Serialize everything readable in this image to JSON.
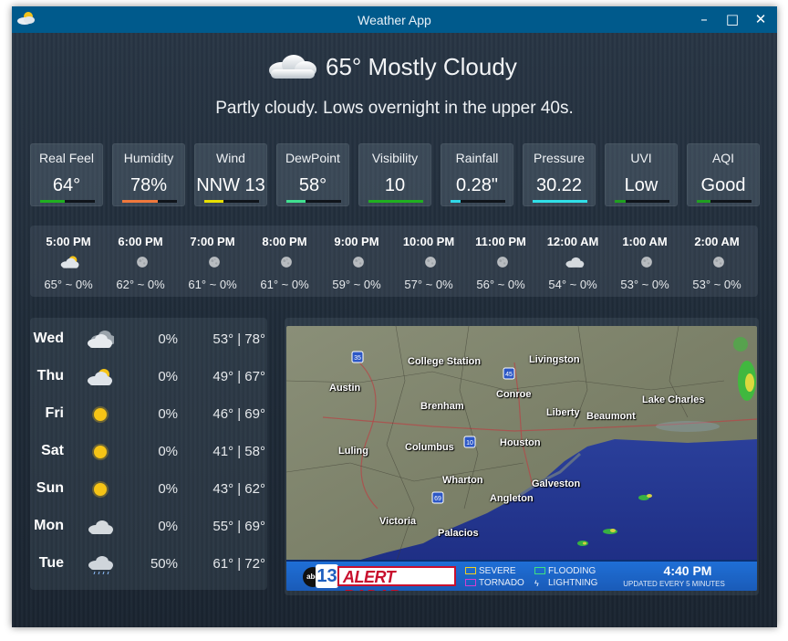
{
  "window": {
    "title": "Weather App",
    "min": "–",
    "max": "□",
    "close": "✕"
  },
  "current": {
    "headline": "65° Mostly Cloudy",
    "icon": "mostly-cloudy-icon",
    "summary": "Partly cloudy. Lows overnight in the upper 40s."
  },
  "stats": [
    {
      "label": "Real Feel",
      "value": "64°",
      "color": "#20b020",
      "level": 0.45
    },
    {
      "label": "Humidity",
      "value": "78%",
      "color": "#f0783c",
      "level": 0.65
    },
    {
      "label": "Wind",
      "value": "NNW 13",
      "color": "#e8e000",
      "level": 0.35
    },
    {
      "label": "DewPoint",
      "value": "58°",
      "color": "#40e090",
      "level": 0.35
    },
    {
      "label": "Visibility",
      "value": "10",
      "color": "#20b020",
      "level": 1.0
    },
    {
      "label": "Rainfall",
      "value": "0.28\"",
      "color": "#30d8e8",
      "level": 0.18
    },
    {
      "label": "Pressure",
      "value": "30.22",
      "color": "#30e0e8",
      "level": 1.0
    },
    {
      "label": "UVI",
      "value": "Low",
      "color": "#20a020",
      "level": 0.2
    },
    {
      "label": "AQI",
      "value": "Good",
      "color": "#20a020",
      "level": 0.25
    }
  ],
  "hourly": [
    {
      "time": "5:00 PM",
      "temps": "65° ~ 0%",
      "icon": "partly-cloudy-icon"
    },
    {
      "time": "6:00 PM",
      "temps": "62° ~ 0%",
      "icon": "moon-icon"
    },
    {
      "time": "7:00 PM",
      "temps": "61° ~ 0%",
      "icon": "moon-icon"
    },
    {
      "time": "8:00 PM",
      "temps": "61° ~ 0%",
      "icon": "moon-icon"
    },
    {
      "time": "9:00 PM",
      "temps": "59° ~ 0%",
      "icon": "moon-icon"
    },
    {
      "time": "10:00 PM",
      "temps": "57° ~ 0%",
      "icon": "moon-icon"
    },
    {
      "time": "11:00 PM",
      "temps": "56° ~ 0%",
      "icon": "moon-icon"
    },
    {
      "time": "12:00 AM",
      "temps": "54° ~ 0%",
      "icon": "cloudy-icon"
    },
    {
      "time": "1:00 AM",
      "temps": "53° ~ 0%",
      "icon": "moon-icon"
    },
    {
      "time": "2:00 AM",
      "temps": "53° ~ 0%",
      "icon": "moon-icon"
    }
  ],
  "daily": [
    {
      "day": "Wed",
      "pct": "0%",
      "range": "53° | 78°",
      "icon": "mostly-cloudy-icon"
    },
    {
      "day": "Thu",
      "pct": "0%",
      "range": "49° | 67°",
      "icon": "partly-cloudy-icon"
    },
    {
      "day": "Fri",
      "pct": "0%",
      "range": "46° | 69°",
      "icon": "sun-icon"
    },
    {
      "day": "Sat",
      "pct": "0%",
      "range": "41° | 58°",
      "icon": "sun-icon"
    },
    {
      "day": "Sun",
      "pct": "0%",
      "range": "43° | 62°",
      "icon": "sun-icon"
    },
    {
      "day": "Mon",
      "pct": "0%",
      "range": "55° | 69°",
      "icon": "cloudy-icon"
    },
    {
      "day": "Tue",
      "pct": "50%",
      "range": "61° | 72°",
      "icon": "rain-cloud-icon"
    }
  ],
  "radar": {
    "cities": [
      "College Station",
      "Livingston",
      "Austin",
      "Conroe",
      "Lake Charles",
      "Brenham",
      "Liberty",
      "Beaumont",
      "Luling",
      "Columbus",
      "Houston",
      "Wharton",
      "Galveston",
      "Angleton",
      "Victoria",
      "Palacios"
    ],
    "highways": [
      "35",
      "45",
      "10",
      "69"
    ],
    "brand_num": "13",
    "brand_net": "abc",
    "brand": "ALERT RADAR",
    "legend": [
      "SEVERE",
      "TORNADO",
      "FLOODING",
      "LIGHTNING"
    ],
    "time": "4:40 PM",
    "updated": "UPDATED EVERY 5 MINUTES"
  }
}
